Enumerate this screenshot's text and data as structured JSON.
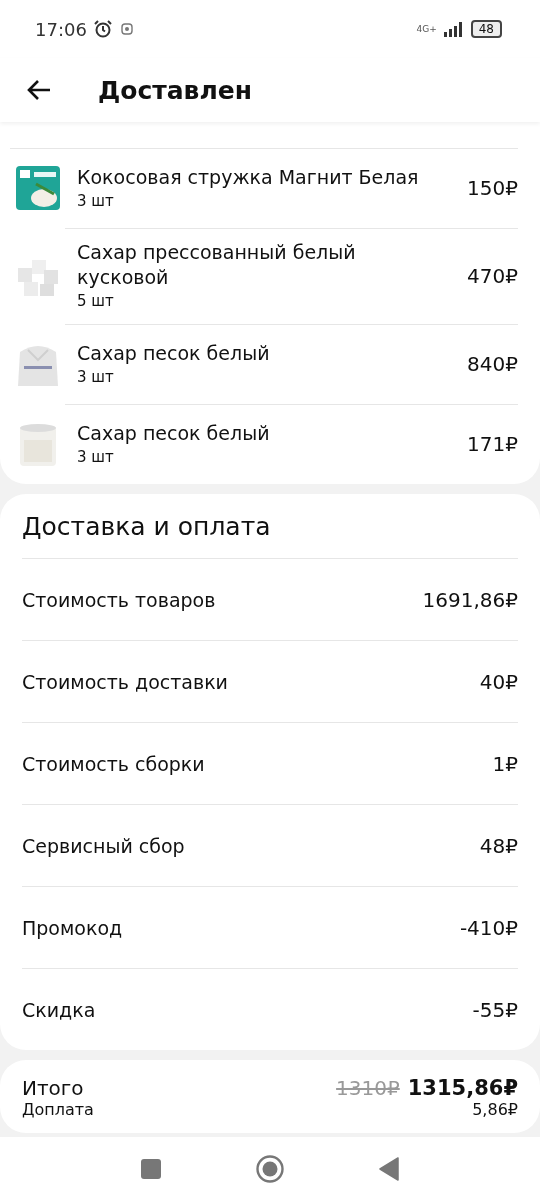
{
  "status_bar": {
    "time": "17:06",
    "network": "4G+",
    "battery": "48"
  },
  "header": {
    "title": "Доставлен"
  },
  "order_items": [
    {
      "name": "Кокосовая стружка Магнит Белая",
      "quantity": "3 шт",
      "price": "150₽"
    },
    {
      "name": "Сахар прессованный белый кусковой",
      "quantity": "5 шт",
      "price": "470₽"
    },
    {
      "name": "Сахар песок белый",
      "quantity": "3 шт",
      "price": "840₽"
    },
    {
      "name": "Сахар песок белый",
      "quantity": "3 шт",
      "price": "171₽"
    }
  ],
  "delivery_payment": {
    "title": "Доставка и оплата",
    "rows": [
      {
        "label": "Стоимость товаров",
        "value": "1691,86₽"
      },
      {
        "label": "Стоимость доставки",
        "value": "40₽"
      },
      {
        "label": "Стоимость сборки",
        "value": "1₽"
      },
      {
        "label": "Сервисный сбор",
        "value": "48₽"
      },
      {
        "label": "Промокод",
        "value": "-410₽"
      },
      {
        "label": "Скидка",
        "value": "-55₽"
      }
    ]
  },
  "total": {
    "label": "Итого",
    "old_value": "1310₽",
    "value": "1315,86₽",
    "surcharge_label": "Доплата",
    "surcharge_value": "5,86₽"
  }
}
